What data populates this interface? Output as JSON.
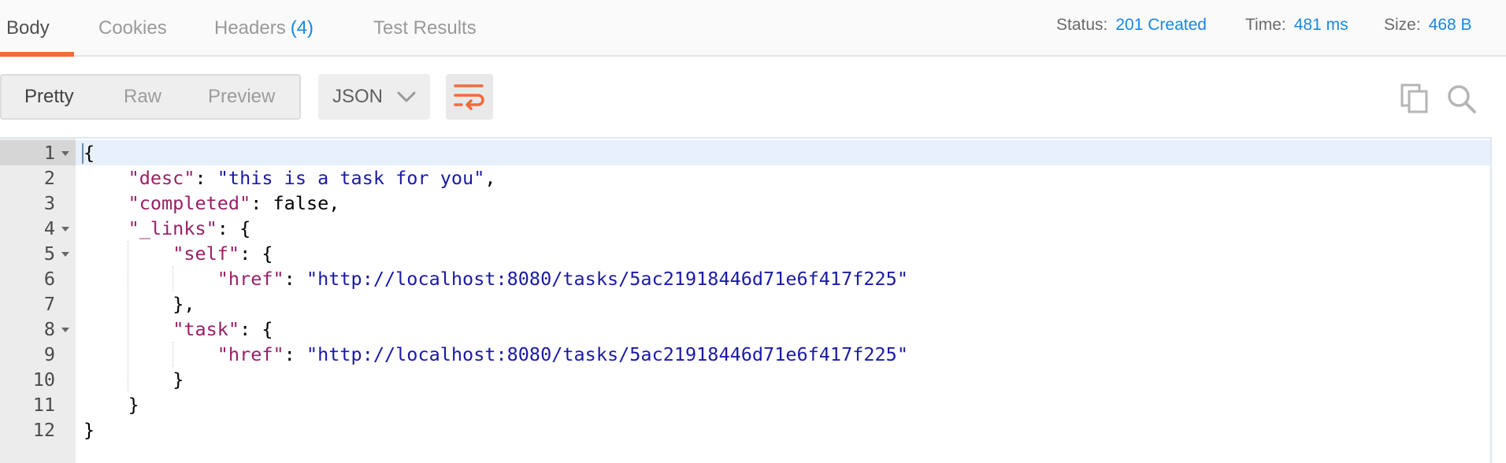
{
  "response_tabs": {
    "body": "Body",
    "cookies": "Cookies",
    "headers": "Headers",
    "headers_count": "(4)",
    "test_results": "Test Results"
  },
  "status_bar": {
    "status_label": "Status:",
    "status_value": "201 Created",
    "time_label": "Time:",
    "time_value": "481 ms",
    "size_label": "Size:",
    "size_value": "468 B"
  },
  "view_modes": {
    "pretty": "Pretty",
    "raw": "Raw",
    "preview": "Preview"
  },
  "format_select": {
    "value": "JSON",
    "icon": "chevron-down-icon"
  },
  "toolbar_icons": [
    "wrap-lines-icon",
    "copy-icon",
    "search-icon"
  ],
  "colors": {
    "accent": "#f26b3a",
    "link_blue": "#1a88e0",
    "json_key": "#991f66",
    "json_string": "#1a1aa6"
  },
  "editor": {
    "lines": [
      {
        "num": "1",
        "text": "{"
      },
      {
        "num": "2",
        "text": "\"desc\": \"this is a task for you\","
      },
      {
        "num": "3",
        "text": "\"completed\": false,"
      },
      {
        "num": "4",
        "text": "\"_links\": {"
      },
      {
        "num": "5",
        "text": "\"self\": {"
      },
      {
        "num": "6",
        "text": "\"href\": \"http://localhost:8080/tasks/5ac21918446d71e6f417f225\""
      },
      {
        "num": "7",
        "text": "},"
      },
      {
        "num": "8",
        "text": "\"task\": {"
      },
      {
        "num": "9",
        "text": "\"href\": \"http://localhost:8080/tasks/5ac21918446d71e6f417f225\""
      },
      {
        "num": "10",
        "text": "}"
      },
      {
        "num": "11",
        "text": "}"
      },
      {
        "num": "12",
        "text": "}"
      }
    ],
    "tokens": {
      "l1_open": "{",
      "l2_key": "\"desc\"",
      "l2_colon": ": ",
      "l2_val": "\"this is a task for you\"",
      "l2_comma": ",",
      "l3_key": "\"completed\"",
      "l3_rest": ": false,",
      "l4_key": "\"_links\"",
      "l4_rest": ": {",
      "l5_key": "\"self\"",
      "l5_rest": ": {",
      "l6_key": "\"href\"",
      "l6_colon": ": ",
      "l6_val": "\"http://localhost:8080/tasks/5ac21918446d71e6f417f225\"",
      "l7_close": "},",
      "l8_key": "\"task\"",
      "l8_rest": ": {",
      "l9_key": "\"href\"",
      "l9_colon": ": ",
      "l9_val": "\"http://localhost:8080/tasks/5ac21918446d71e6f417f225\"",
      "l10_close": "}",
      "l11_close": "}",
      "l12_close": "}"
    }
  }
}
